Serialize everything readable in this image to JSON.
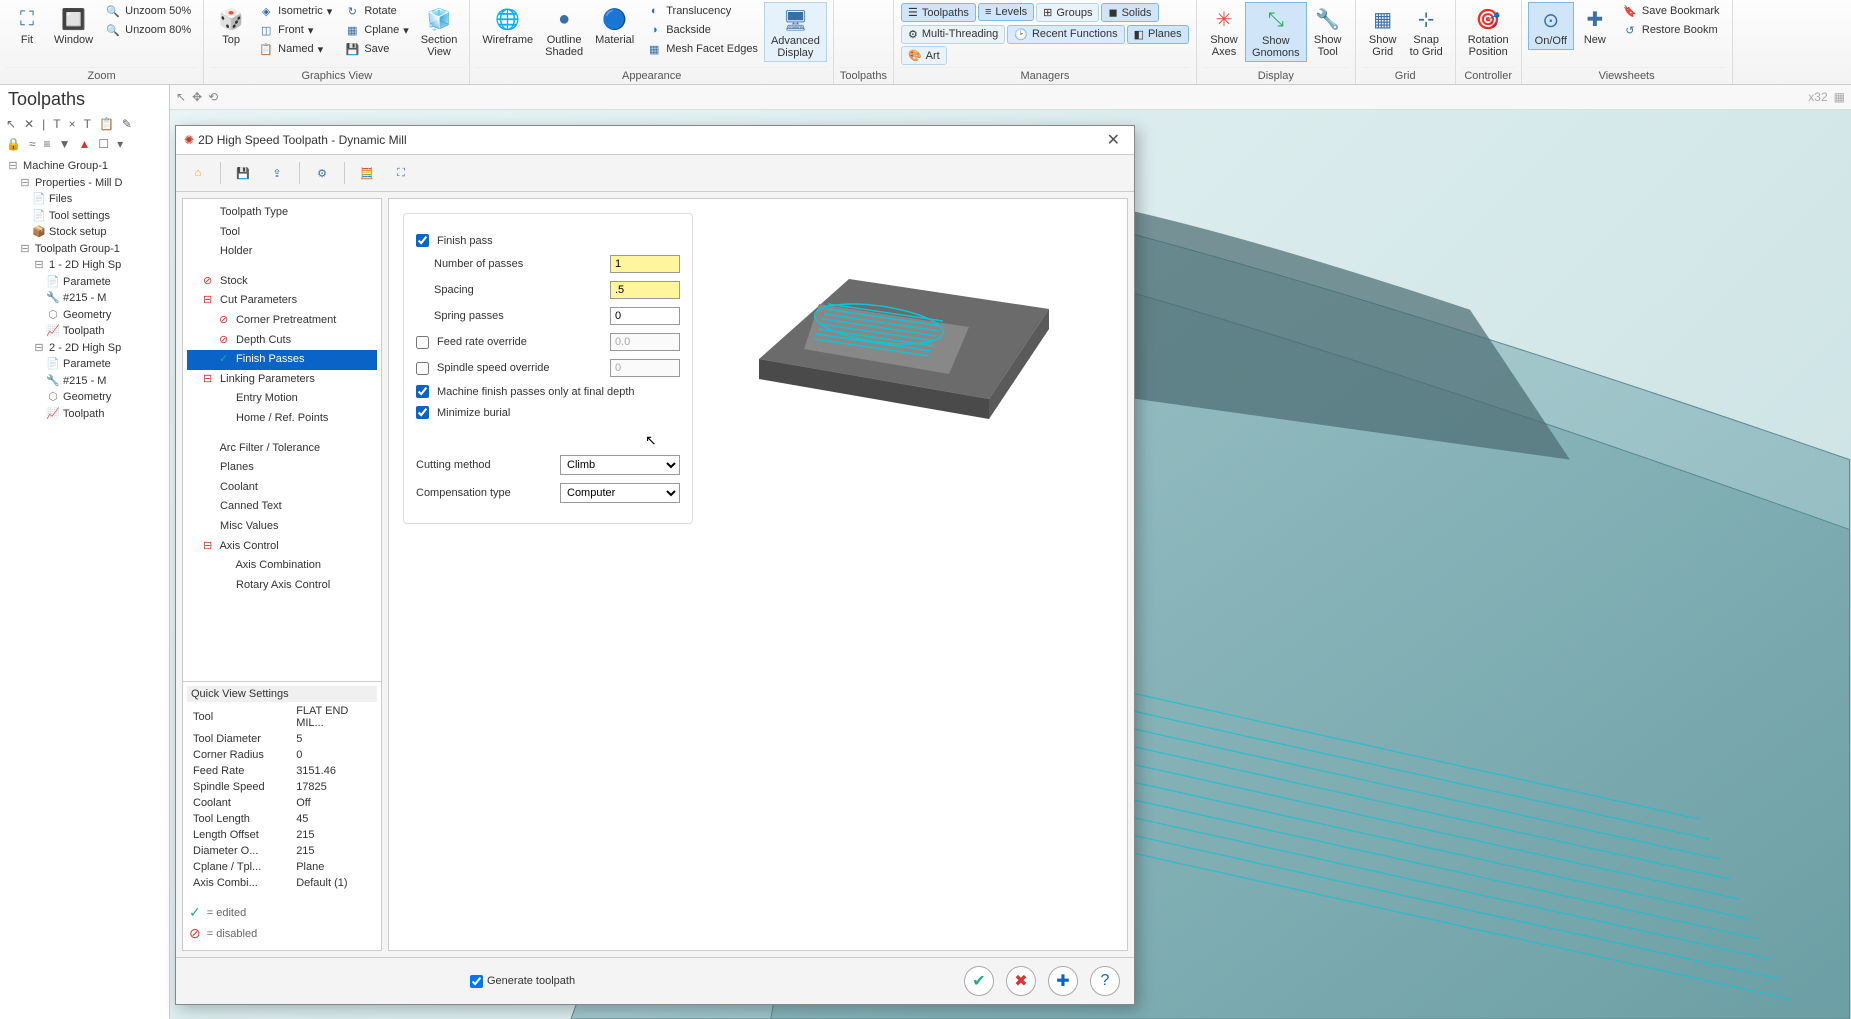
{
  "ribbon": {
    "zoom": {
      "fit": "Fit",
      "window": "Window",
      "unzoom50": "Unzoom 50%",
      "unzoom80": "Unzoom 80%",
      "label": "Zoom"
    },
    "gview": {
      "top": "Top",
      "isometric": "Isometric",
      "rotate": "Rotate",
      "front": "Front",
      "cplane": "Cplane",
      "named": "Named",
      "save": "Save",
      "section": "Section\nView",
      "label": "Graphics View"
    },
    "appearance": {
      "wireframe": "Wireframe",
      "outline": "Outline\nShaded",
      "material": "Material",
      "translucency": "Translucency",
      "backside": "Backside",
      "mesh": "Mesh Facet Edges",
      "advanced": "Advanced\nDisplay",
      "label": "Appearance"
    },
    "toolpaths": {
      "label": "Toolpaths"
    },
    "managers": {
      "toolpaths": "Toolpaths",
      "solids": "Solids",
      "planes": "Planes",
      "levels": "Levels",
      "art": "Art",
      "multi": "Multi-Threading",
      "groups": "Groups",
      "recent": "Recent Functions",
      "label": "Managers"
    },
    "display": {
      "axes": "Show\nAxes",
      "gnomons": "Show\nGnomons",
      "tool": "Show\nTool",
      "label": "Display"
    },
    "grid": {
      "show": "Show\nGrid",
      "snap": "Snap\nto Grid",
      "label": "Grid"
    },
    "controller": {
      "rotation": "Rotation\nPosition",
      "label": "Controller"
    },
    "viewsheets": {
      "onoff": "On/Off",
      "new": "New",
      "savebm": "Save Bookmark",
      "restorebm": "Restore Bookm",
      "label": "Viewsheets"
    }
  },
  "leftPanel": {
    "title": "Toolpaths",
    "tree": [
      {
        "t": "Machine Group-1",
        "d": 0,
        "i": "⊟"
      },
      {
        "t": "Properties - Mill D",
        "d": 1,
        "i": "⊟"
      },
      {
        "t": "Files",
        "d": 2,
        "i": "📄"
      },
      {
        "t": "Tool settings",
        "d": 2,
        "i": "📄"
      },
      {
        "t": "Stock setup",
        "d": 2,
        "i": "📦"
      },
      {
        "t": "Toolpath Group-1",
        "d": 1,
        "i": "⊟"
      },
      {
        "t": "1 - 2D High Sp",
        "d": 2,
        "i": "⊟"
      },
      {
        "t": "Paramete",
        "d": 3,
        "i": "📄"
      },
      {
        "t": "#215 - M",
        "d": 3,
        "i": "🔧"
      },
      {
        "t": "Geometry",
        "d": 3,
        "i": "⬡"
      },
      {
        "t": "Toolpath",
        "d": 3,
        "i": "📈"
      },
      {
        "t": "2 - 2D High Sp",
        "d": 2,
        "i": "⊟"
      },
      {
        "t": "Paramete",
        "d": 3,
        "i": "📄"
      },
      {
        "t": "#215 - M",
        "d": 3,
        "i": "🔧"
      },
      {
        "t": "Geometry",
        "d": 3,
        "i": "⬡"
      },
      {
        "t": "Toolpath",
        "d": 3,
        "i": "📈"
      }
    ]
  },
  "dialog": {
    "title": "2D High Speed Toolpath - Dynamic Mill",
    "nav": [
      {
        "t": "Toolpath Type",
        "d": 1
      },
      {
        "t": "Tool",
        "d": 1
      },
      {
        "t": "Holder",
        "d": 1
      },
      {
        "t": "",
        "d": 0,
        "blank": true
      },
      {
        "t": "Stock",
        "d": 1,
        "i": "⊘",
        "c": "red"
      },
      {
        "t": "Cut Parameters",
        "d": 1,
        "exp": true
      },
      {
        "t": "Corner Pretreatment",
        "d": 2,
        "i": "⊘",
        "c": "red"
      },
      {
        "t": "Depth Cuts",
        "d": 2,
        "i": "⊘",
        "c": "red"
      },
      {
        "t": "Finish Passes",
        "d": 2,
        "i": "✓",
        "c": "green",
        "sel": true
      },
      {
        "t": "Linking Parameters",
        "d": 1,
        "exp": true
      },
      {
        "t": "Entry Motion",
        "d": 2
      },
      {
        "t": "Home / Ref. Points",
        "d": 2
      },
      {
        "t": "",
        "d": 0,
        "blank": true
      },
      {
        "t": "Arc Filter / Tolerance",
        "d": 1
      },
      {
        "t": "Planes",
        "d": 1
      },
      {
        "t": "Coolant",
        "d": 1
      },
      {
        "t": "Canned Text",
        "d": 1
      },
      {
        "t": "Misc Values",
        "d": 1
      },
      {
        "t": "Axis Control",
        "d": 1,
        "exp": true
      },
      {
        "t": "Axis Combination",
        "d": 2
      },
      {
        "t": "Rotary Axis Control",
        "d": 2
      }
    ],
    "qvs": {
      "title": "Quick View Settings",
      "rows": [
        [
          "Tool",
          "FLAT END MIL..."
        ],
        [
          "Tool Diameter",
          "5"
        ],
        [
          "Corner Radius",
          "0"
        ],
        [
          "Feed Rate",
          "3151.46"
        ],
        [
          "Spindle Speed",
          "17825"
        ],
        [
          "Coolant",
          "Off"
        ],
        [
          "Tool Length",
          "45"
        ],
        [
          "Length Offset",
          "215"
        ],
        [
          "Diameter O...",
          "215"
        ],
        [
          "Cplane / Tpl...",
          "Plane"
        ],
        [
          "Axis Combi...",
          "Default (1)"
        ]
      ]
    },
    "legend": {
      "edited": "= edited",
      "disabled": "= disabled"
    },
    "form": {
      "finishPass": "Finish pass",
      "numberOfPasses": "Number of passes",
      "numberOfPassesVal": "1",
      "spacing": "Spacing",
      "spacingVal": ".5",
      "springPasses": "Spring passes",
      "springPassesVal": "0",
      "feedOverride": "Feed rate override",
      "feedOverrideVal": "0.0",
      "spindleOverride": "Spindle speed override",
      "spindleOverrideVal": "0",
      "finalDepth": "Machine finish passes only at final depth",
      "minimizeBurial": "Minimize burial",
      "cuttingMethod": "Cutting method",
      "cuttingMethodVal": "Climb",
      "compType": "Compensation type",
      "compVal": "Computer"
    },
    "footer": {
      "generate": "Generate toolpath"
    }
  }
}
